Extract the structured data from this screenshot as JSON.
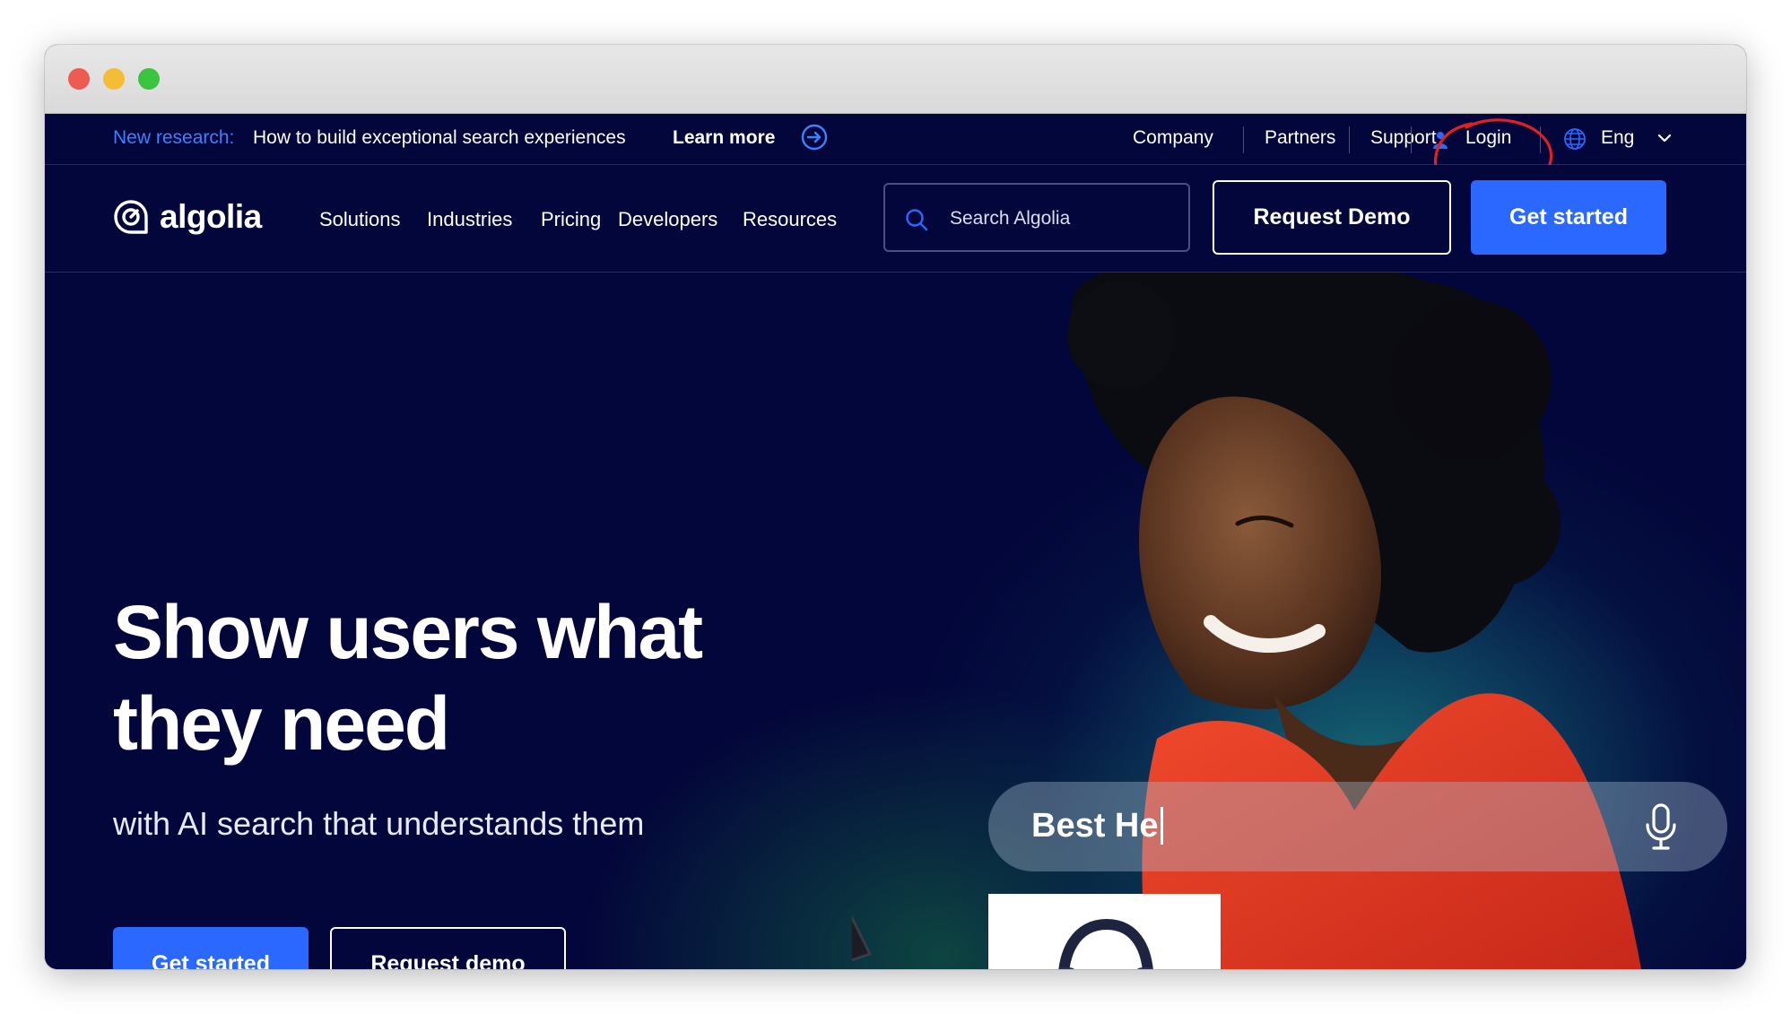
{
  "window": {
    "controls": [
      "close",
      "minimize",
      "zoom"
    ]
  },
  "announcement": {
    "tag": "New research:",
    "message": "How to build exceptional search experiences",
    "cta": "Learn more"
  },
  "topnav": {
    "company": "Company",
    "partners": "Partners",
    "support": "Support",
    "login": "Login",
    "language": "Eng"
  },
  "header": {
    "logo_text": "algolia",
    "nav": [
      "Solutions",
      "Industries",
      "Pricing",
      "Developers",
      "Resources"
    ],
    "search_placeholder": "Search Algolia",
    "request_demo": "Request Demo",
    "get_started": "Get started"
  },
  "hero": {
    "title": "Show users what they need",
    "subtitle": "with AI search that understands them",
    "primary_cta": "Get started",
    "secondary_cta": "Request demo",
    "demo_query": "Best He"
  },
  "colors": {
    "navy": "#03063a",
    "accent_blue": "#2a68ff",
    "tag_blue": "#3b82ff",
    "annotation_red": "#e0211f"
  },
  "icons": [
    "arrow-right-circle-icon",
    "user-icon",
    "globe-icon",
    "chevron-down-icon",
    "search-icon",
    "microphone-icon",
    "headphones-icon"
  ]
}
